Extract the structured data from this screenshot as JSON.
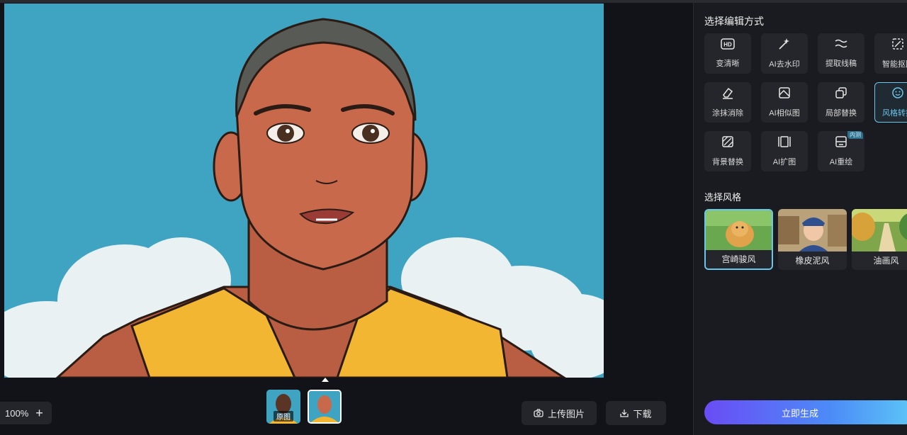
{
  "zoom": {
    "level": "100%",
    "plus": "+"
  },
  "thumbnails": {
    "original_tag": "原图"
  },
  "buttons": {
    "upload": "上传图片",
    "download": "下载",
    "generate": "立即生成"
  },
  "panel": {
    "edit_title": "选择编辑方式",
    "tools": [
      {
        "label": "变清晰",
        "icon": "hd-icon"
      },
      {
        "label": "AI去水印",
        "icon": "magic-wand-icon"
      },
      {
        "label": "提取线稿",
        "icon": "lineart-icon"
      },
      {
        "label": "智能抠图",
        "icon": "cutout-icon"
      },
      {
        "label": "涂抹消除",
        "icon": "eraser-icon"
      },
      {
        "label": "AI相似图",
        "icon": "similar-image-icon"
      },
      {
        "label": "局部替换",
        "icon": "partial-replace-icon"
      },
      {
        "label": "风格转换",
        "icon": "style-transfer-icon"
      },
      {
        "label": "背景替换",
        "icon": "background-replace-icon"
      },
      {
        "label": "AI扩图",
        "icon": "expand-icon"
      },
      {
        "label": "AI重绘",
        "icon": "redraw-icon",
        "badge": "内测"
      }
    ],
    "style_title": "选择风格",
    "styles": [
      {
        "label": "宫崎骏风"
      },
      {
        "label": "橡皮泥风"
      },
      {
        "label": "油画风"
      }
    ]
  },
  "colors": {
    "accent": "#6cc6ea",
    "sky": "#3fa4c2",
    "skin": "#c8694b",
    "shirt": "#f2b632"
  }
}
